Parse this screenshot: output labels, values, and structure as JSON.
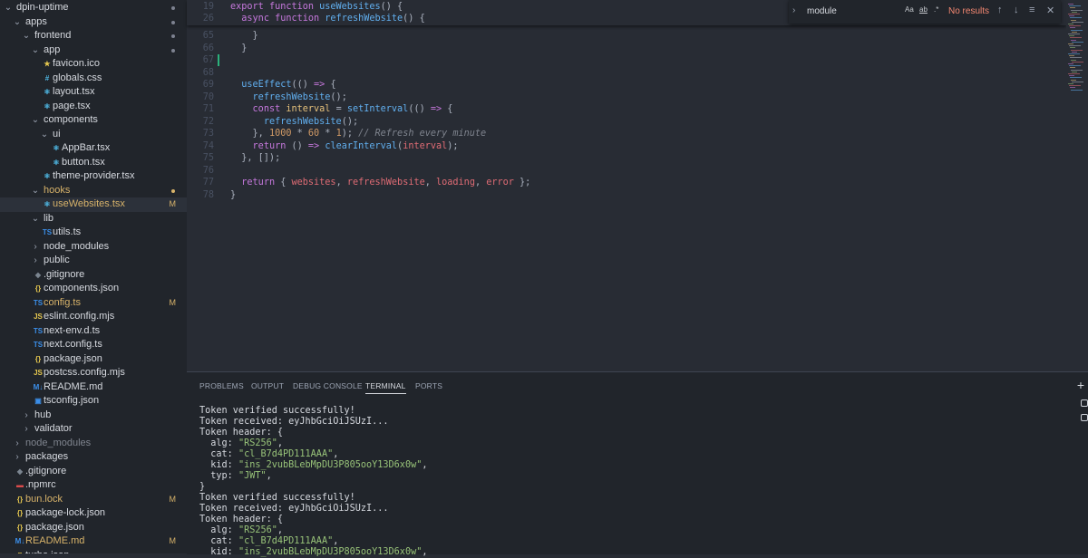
{
  "explorer": {
    "items": [
      {
        "label": "dpin-uptime",
        "indent": 0,
        "type": "folder",
        "open": true,
        "icon": "",
        "deco": "dot"
      },
      {
        "label": "apps",
        "indent": 1,
        "type": "folder",
        "open": true,
        "icon": "",
        "deco": "dot"
      },
      {
        "label": "frontend",
        "indent": 2,
        "type": "folder",
        "open": true,
        "icon": "",
        "deco": "dot"
      },
      {
        "label": "app",
        "indent": 3,
        "type": "folder",
        "open": true,
        "icon": "",
        "deco": "dot"
      },
      {
        "label": "favicon.ico",
        "indent": 4,
        "type": "file",
        "icon": "star-icon",
        "deco": ""
      },
      {
        "label": "globals.css",
        "indent": 4,
        "type": "file",
        "icon": "css-icon",
        "deco": ""
      },
      {
        "label": "layout.tsx",
        "indent": 4,
        "type": "file",
        "icon": "react-icon",
        "deco": ""
      },
      {
        "label": "page.tsx",
        "indent": 4,
        "type": "file",
        "icon": "react-icon",
        "deco": ""
      },
      {
        "label": "components",
        "indent": 3,
        "type": "folder",
        "open": true,
        "icon": "",
        "deco": ""
      },
      {
        "label": "ui",
        "indent": 4,
        "type": "folder",
        "open": true,
        "icon": "",
        "deco": ""
      },
      {
        "label": "AppBar.tsx",
        "indent": 5,
        "type": "file",
        "icon": "react-icon",
        "deco": ""
      },
      {
        "label": "button.tsx",
        "indent": 5,
        "type": "file",
        "icon": "react-icon",
        "deco": ""
      },
      {
        "label": "theme-provider.tsx",
        "indent": 4,
        "type": "file",
        "icon": "react-icon",
        "deco": ""
      },
      {
        "label": "hooks",
        "indent": 3,
        "type": "folder",
        "open": true,
        "icon": "",
        "deco": "dot",
        "modified": true
      },
      {
        "label": "useWebsites.tsx",
        "indent": 4,
        "type": "file",
        "icon": "react-icon",
        "deco": "M",
        "modified": true,
        "selected": true
      },
      {
        "label": "lib",
        "indent": 3,
        "type": "folder",
        "open": true,
        "icon": "",
        "deco": ""
      },
      {
        "label": "utils.ts",
        "indent": 4,
        "type": "file",
        "icon": "ts-icon",
        "deco": ""
      },
      {
        "label": "node_modules",
        "indent": 3,
        "type": "folder",
        "open": false,
        "icon": "",
        "deco": ""
      },
      {
        "label": "public",
        "indent": 3,
        "type": "folder",
        "open": false,
        "icon": "",
        "deco": ""
      },
      {
        "label": ".gitignore",
        "indent": 3,
        "type": "file",
        "icon": "git-icon",
        "deco": ""
      },
      {
        "label": "components.json",
        "indent": 3,
        "type": "file",
        "icon": "json-icon",
        "deco": ""
      },
      {
        "label": "config.ts",
        "indent": 3,
        "type": "file",
        "icon": "ts-icon",
        "deco": "M",
        "modified": true
      },
      {
        "label": "eslint.config.mjs",
        "indent": 3,
        "type": "file",
        "icon": "js-icon",
        "deco": ""
      },
      {
        "label": "next-env.d.ts",
        "indent": 3,
        "type": "file",
        "icon": "ts-icon",
        "deco": ""
      },
      {
        "label": "next.config.ts",
        "indent": 3,
        "type": "file",
        "icon": "ts-icon",
        "deco": ""
      },
      {
        "label": "package.json",
        "indent": 3,
        "type": "file",
        "icon": "json-icon",
        "deco": ""
      },
      {
        "label": "postcss.config.mjs",
        "indent": 3,
        "type": "file",
        "icon": "js-icon",
        "deco": ""
      },
      {
        "label": "README.md",
        "indent": 3,
        "type": "file",
        "icon": "markdown-icon",
        "deco": ""
      },
      {
        "label": "tsconfig.json",
        "indent": 3,
        "type": "file",
        "icon": "tsconfig-icon",
        "deco": ""
      },
      {
        "label": "hub",
        "indent": 2,
        "type": "folder",
        "open": false,
        "icon": "",
        "deco": ""
      },
      {
        "label": "validator",
        "indent": 2,
        "type": "folder",
        "open": false,
        "icon": "",
        "deco": ""
      },
      {
        "label": "node_modules",
        "indent": 1,
        "type": "folder",
        "open": false,
        "icon": "",
        "deco": "",
        "muted": true
      },
      {
        "label": "packages",
        "indent": 1,
        "type": "folder",
        "open": false,
        "icon": "",
        "deco": ""
      },
      {
        "label": ".gitignore",
        "indent": 1,
        "type": "file",
        "icon": "git-icon",
        "deco": ""
      },
      {
        "label": ".npmrc",
        "indent": 1,
        "type": "file",
        "icon": "npm-icon",
        "deco": ""
      },
      {
        "label": "bun.lock",
        "indent": 1,
        "type": "file",
        "icon": "json-icon",
        "deco": "M",
        "modified": true
      },
      {
        "label": "package-lock.json",
        "indent": 1,
        "type": "file",
        "icon": "json-icon",
        "deco": ""
      },
      {
        "label": "package.json",
        "indent": 1,
        "type": "file",
        "icon": "json-icon",
        "deco": ""
      },
      {
        "label": "README.md",
        "indent": 1,
        "type": "file",
        "icon": "markdown-icon",
        "deco": "M",
        "modified": true
      },
      {
        "label": "turbo.json",
        "indent": 1,
        "type": "file",
        "icon": "json-icon",
        "deco": ""
      }
    ]
  },
  "editor": {
    "sticky": [
      {
        "ln": "19",
        "tokens": [
          [
            "kw",
            "export "
          ],
          [
            "kw",
            "function "
          ],
          [
            "fn",
            "useWebsites"
          ],
          [
            "pl",
            "() {"
          ]
        ]
      },
      {
        "ln": "26",
        "tokens": [
          [
            "pl",
            "  "
          ],
          [
            "kw",
            "async "
          ],
          [
            "kw",
            "function "
          ],
          [
            "fn",
            "refreshWebsite"
          ],
          [
            "pl",
            "() {"
          ]
        ]
      }
    ],
    "lines": [
      {
        "ln": "65",
        "tokens": [
          [
            "pl",
            "    }"
          ]
        ]
      },
      {
        "ln": "66",
        "tokens": [
          [
            "pl",
            "  }"
          ]
        ]
      },
      {
        "ln": "67",
        "tokens": [
          [
            "pl",
            ""
          ]
        ]
      },
      {
        "ln": "68",
        "tokens": [
          [
            "pl",
            ""
          ]
        ]
      },
      {
        "ln": "69",
        "tokens": [
          [
            "pl",
            "  "
          ],
          [
            "fn",
            "useEffect"
          ],
          [
            "pl",
            "(() "
          ],
          [
            "kw",
            "=>"
          ],
          [
            "pl",
            " {"
          ]
        ]
      },
      {
        "ln": "70",
        "tokens": [
          [
            "pl",
            "    "
          ],
          [
            "fn",
            "refreshWebsite"
          ],
          [
            "pl",
            "();"
          ]
        ]
      },
      {
        "ln": "71",
        "tokens": [
          [
            "pl",
            "    "
          ],
          [
            "kw",
            "const "
          ],
          [
            "var",
            "interval"
          ],
          [
            "pl",
            " = "
          ],
          [
            "fn",
            "setInterval"
          ],
          [
            "pl",
            "(() "
          ],
          [
            "kw",
            "=>"
          ],
          [
            "pl",
            " {"
          ]
        ]
      },
      {
        "ln": "72",
        "tokens": [
          [
            "pl",
            "      "
          ],
          [
            "fn",
            "refreshWebsite"
          ],
          [
            "pl",
            "();"
          ]
        ]
      },
      {
        "ln": "73",
        "tokens": [
          [
            "pl",
            "    }, "
          ],
          [
            "num",
            "1000"
          ],
          [
            "pl",
            " * "
          ],
          [
            "num",
            "60"
          ],
          [
            "pl",
            " * "
          ],
          [
            "num",
            "1"
          ],
          [
            "pl",
            "); "
          ],
          [
            "cm",
            "// Refresh every minute"
          ]
        ]
      },
      {
        "ln": "74",
        "tokens": [
          [
            "pl",
            "    "
          ],
          [
            "kw",
            "return "
          ],
          [
            "pl",
            "() "
          ],
          [
            "kw",
            "=>"
          ],
          [
            "pl",
            " "
          ],
          [
            "fn",
            "clearInterval"
          ],
          [
            "pl",
            "("
          ],
          [
            "rd",
            "interval"
          ],
          [
            "pl",
            ");"
          ]
        ]
      },
      {
        "ln": "75",
        "tokens": [
          [
            "pl",
            "  }, []);"
          ]
        ]
      },
      {
        "ln": "76",
        "tokens": [
          [
            "pl",
            ""
          ]
        ]
      },
      {
        "ln": "77",
        "tokens": [
          [
            "pl",
            "  "
          ],
          [
            "kw",
            "return "
          ],
          [
            "pl",
            "{ "
          ],
          [
            "rd",
            "websites"
          ],
          [
            "pl",
            ", "
          ],
          [
            "rd",
            "refreshWebsite"
          ],
          [
            "pl",
            ", "
          ],
          [
            "rd",
            "loading"
          ],
          [
            "pl",
            ", "
          ],
          [
            "rd",
            "error"
          ],
          [
            "pl",
            " };"
          ]
        ]
      },
      {
        "ln": "78",
        "tokens": [
          [
            "pl",
            "}"
          ]
        ]
      }
    ]
  },
  "find": {
    "value": "module",
    "options": [
      "Aa",
      "ab",
      ".*"
    ],
    "result": "No results"
  },
  "panel": {
    "tabs": [
      "PROBLEMS",
      "OUTPUT",
      "DEBUG CONSOLE",
      "TERMINAL",
      "PORTS"
    ],
    "active_tab": "TERMINAL",
    "terminal": [
      [
        [
          "key",
          "Token verified successfully!"
        ]
      ],
      [
        [
          "key",
          "Token received: eyJhbGciOiJSUzI..."
        ]
      ],
      [
        [
          "key",
          "Token header: {"
        ]
      ],
      [
        [
          "key",
          "  alg: "
        ],
        [
          "str",
          "\"RS256\""
        ],
        [
          "key",
          ","
        ]
      ],
      [
        [
          "key",
          "  cat: "
        ],
        [
          "str",
          "\"cl_B7d4PD111AAA\""
        ],
        [
          "key",
          ","
        ]
      ],
      [
        [
          "key",
          "  kid: "
        ],
        [
          "str",
          "\"ins_2vubBLebMpDU3P805ooY13D6x0w\""
        ],
        [
          "key",
          ","
        ]
      ],
      [
        [
          "key",
          "  typ: "
        ],
        [
          "str",
          "\"JWT\""
        ],
        [
          "key",
          ","
        ]
      ],
      [
        [
          "key",
          "}"
        ]
      ],
      [
        [
          "key",
          "Token verified successfully!"
        ]
      ],
      [
        [
          "key",
          "Token received: eyJhbGciOiJSUzI..."
        ]
      ],
      [
        [
          "key",
          "Token header: {"
        ]
      ],
      [
        [
          "key",
          "  alg: "
        ],
        [
          "str",
          "\"RS256\""
        ],
        [
          "key",
          ","
        ]
      ],
      [
        [
          "key",
          "  cat: "
        ],
        [
          "str",
          "\"cl_B7d4PD111AAA\""
        ],
        [
          "key",
          ","
        ]
      ],
      [
        [
          "key",
          "  kid: "
        ],
        [
          "str",
          "\"ins_2vubBLebMpDU3P805ooY13D6x0w\""
        ],
        [
          "key",
          ","
        ]
      ]
    ]
  },
  "colors": {
    "folder_icon_chevron": "#9da5b4",
    "modified": "#d8b36a",
    "react_icon": "#4fb9e6",
    "ts_icon": "#3b8ee8",
    "json_icon": "#e6c84f",
    "js_icon": "#e6c84f",
    "css_icon": "#4fb9e6",
    "git_icon": "#7b8590",
    "npm_icon": "#d94b4b",
    "markdown_icon": "#3b8ee8",
    "star_icon": "#e6c84f",
    "tsconfig_icon": "#3b8ee8"
  }
}
